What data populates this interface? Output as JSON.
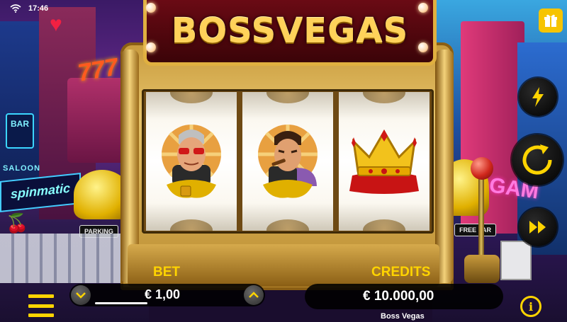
{
  "status_bar": {
    "time": "17:46"
  },
  "game": {
    "title": "BOSSVEGAS",
    "name": "Boss Vegas"
  },
  "scenery": {
    "left_signs": {
      "bar": "BAR",
      "saloon": "SALOON",
      "spinmatic": "spinmatic",
      "parking": "PARKING",
      "sevens": "777"
    },
    "right_signs": {
      "game": "GAM",
      "parking": "FREE PAR"
    }
  },
  "reels": [
    {
      "symbol": "boss-sunglasses-icon"
    },
    {
      "symbol": "boss-cigar-icon"
    },
    {
      "symbol": "crown-icon"
    }
  ],
  "bet": {
    "label": "BET",
    "value": "€ 1,00"
  },
  "credits": {
    "label": "CREDITS",
    "value": "€ 10.000,00"
  },
  "controls": {
    "turbo": "lightning-icon",
    "spin": "spin-icon",
    "autoplay": "fast-forward-icon",
    "gift": "gift-icon",
    "menu": "menu-icon",
    "info": "info-icon",
    "info_glyph": "i"
  },
  "colors": {
    "accent": "#ffd400",
    "marquee": "#6a0a14",
    "gold": "#e0b040"
  }
}
